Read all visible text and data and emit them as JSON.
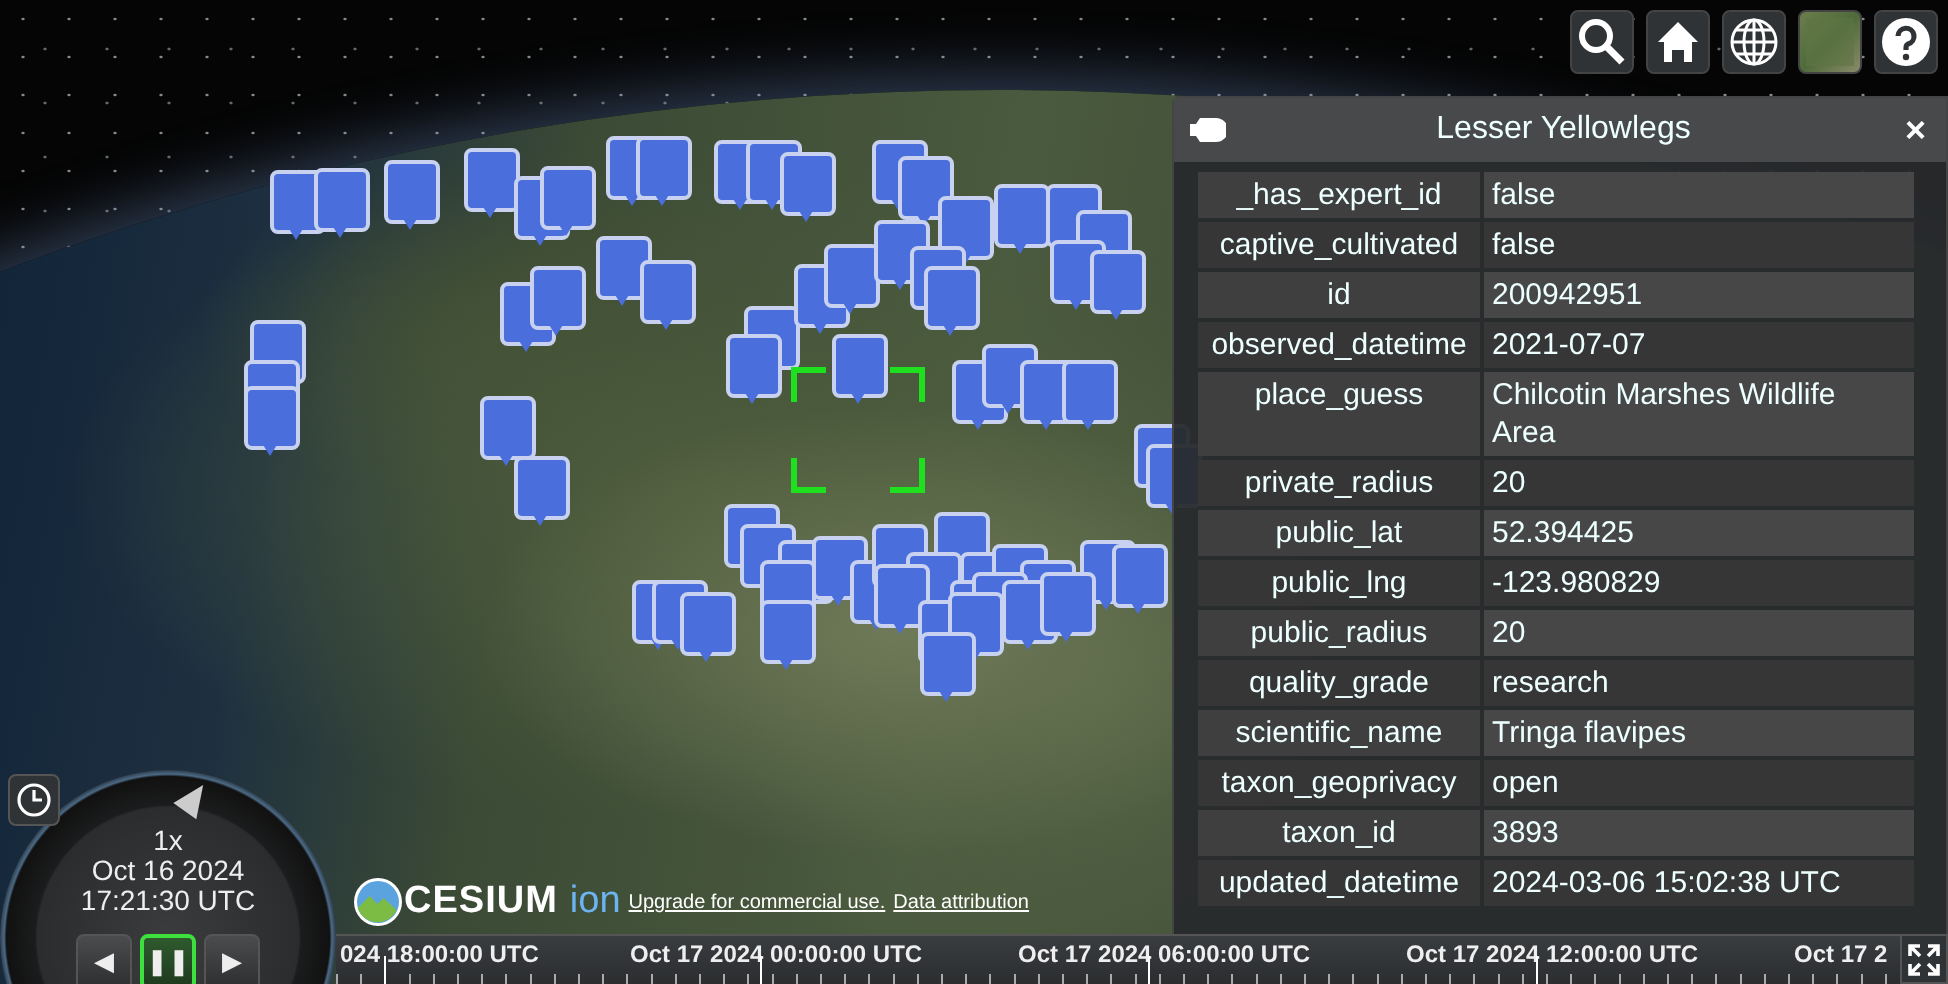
{
  "infobox": {
    "title": "Lesser Yellowlegs",
    "close": "×",
    "rows": [
      {
        "key": "_has_expert_id",
        "value": "false"
      },
      {
        "key": "captive_cultivated",
        "value": "false"
      },
      {
        "key": "id",
        "value": "200942951"
      },
      {
        "key": "observed_datetime",
        "value": "2021-07-07"
      },
      {
        "key": "place_guess",
        "value": "Chilcotin Marshes Wildlife Area"
      },
      {
        "key": "private_radius",
        "value": "20"
      },
      {
        "key": "public_lat",
        "value": "52.394425"
      },
      {
        "key": "public_lng",
        "value": "-123.980829"
      },
      {
        "key": "public_radius",
        "value": "20"
      },
      {
        "key": "quality_grade",
        "value": "research"
      },
      {
        "key": "scientific_name",
        "value": "Tringa flavipes"
      },
      {
        "key": "taxon_geoprivacy",
        "value": "open"
      },
      {
        "key": "taxon_id",
        "value": "3893"
      },
      {
        "key": "updated_datetime",
        "value": "2024-03-06 15:02:38 UTC"
      }
    ]
  },
  "animation": {
    "speed": "1x",
    "date": "Oct 16 2024",
    "time": "17:21:30 UTC",
    "controls": [
      {
        "glyph": "◀",
        "selected": false
      },
      {
        "glyph": "❚❚",
        "selected": true
      },
      {
        "glyph": "▶",
        "selected": false
      }
    ]
  },
  "credits": {
    "logo": "CESIUM",
    "logo_suffix": "ion",
    "links": [
      "Upgrade for commercial use.",
      "Data attribution"
    ]
  },
  "timeline": {
    "labels": [
      "024 18:00:00 UTC",
      "Oct 17 2024 00:00:00 UTC",
      "Oct 17 2024 06:00:00 UTC",
      "Oct 17 2024 12:00:00 UTC",
      "Oct 17 2"
    ]
  }
}
